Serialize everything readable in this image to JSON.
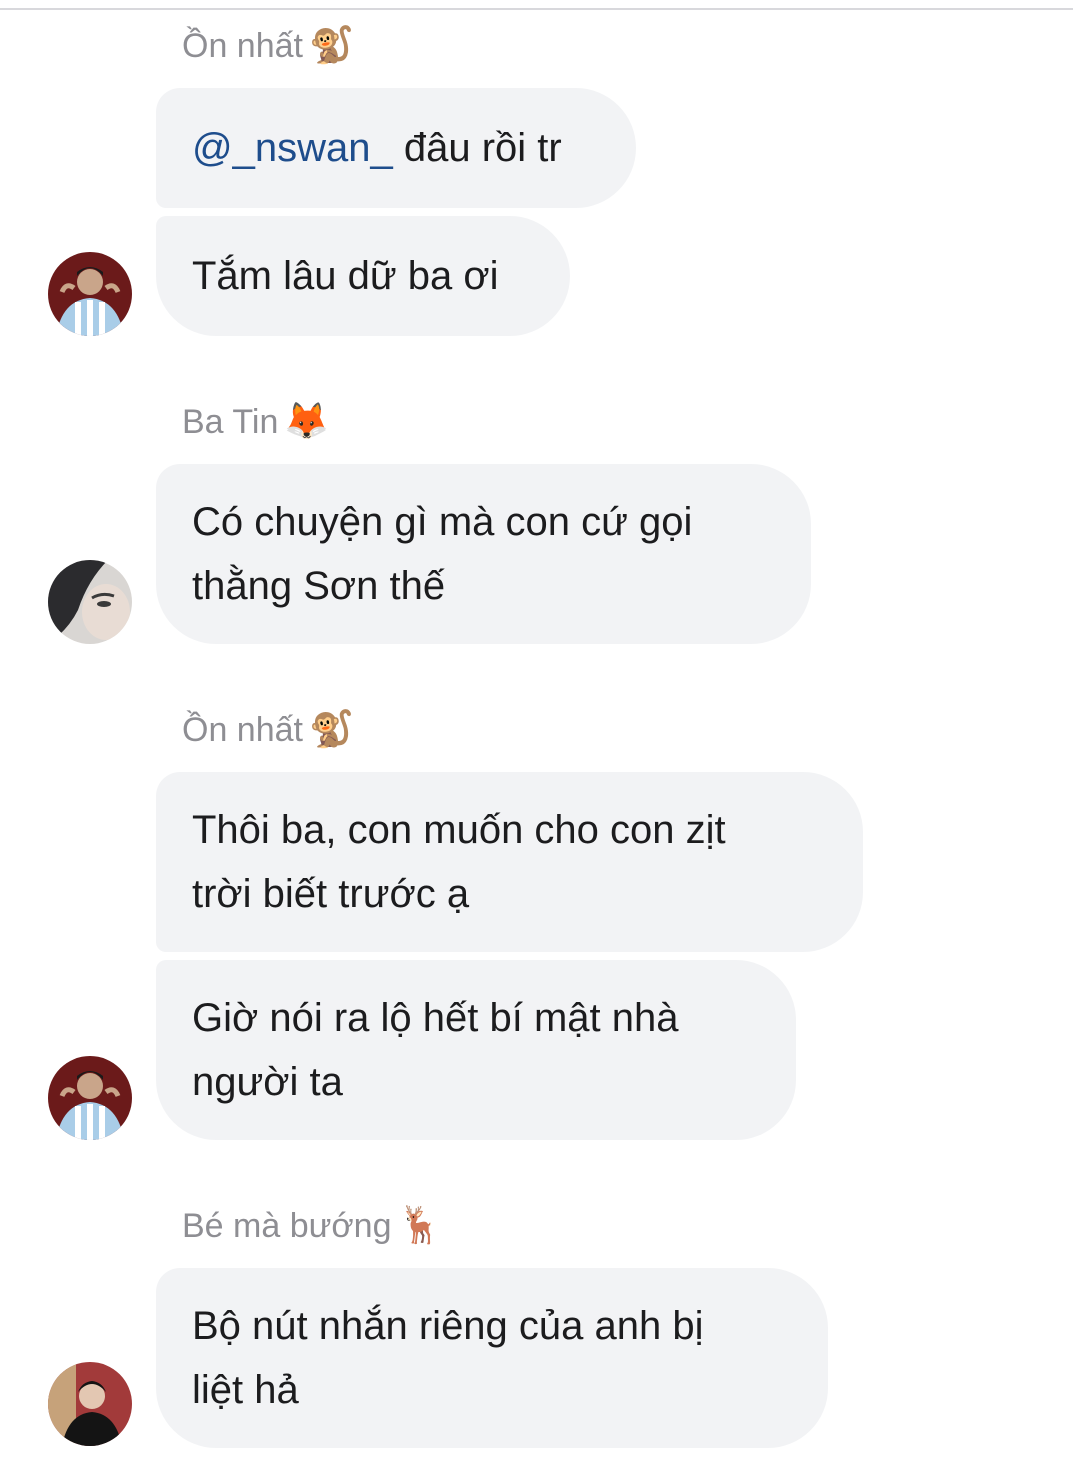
{
  "messages": [
    {
      "sender": "Ồn nhất",
      "sender_emoji": "🐒",
      "emoji_name": "monkey-emoji",
      "bubbles": [
        {
          "mention": "@_nswan_",
          "text": " đâu rồi tr"
        },
        {
          "text": "Tắm lâu dữ ba ơi"
        }
      ]
    },
    {
      "sender": "Ba Tin",
      "sender_emoji": "🦊",
      "emoji_name": "fox-emoji",
      "bubbles": [
        {
          "line1": "Có chuyện gì mà con cứ gọi",
          "line2": "thằng Sơn thế"
        }
      ]
    },
    {
      "sender": "Ồn nhất",
      "sender_emoji": "🐒",
      "emoji_name": "monkey-emoji",
      "bubbles": [
        {
          "line1": "Thôi ba, con muốn cho con zịt",
          "line2": "trời biết trước ạ"
        },
        {
          "line1": "Giờ nói ra lộ hết bí mật nhà",
          "line2": "người ta"
        }
      ]
    },
    {
      "sender": "Bé mà bướng",
      "sender_emoji": "🦌",
      "emoji_name": "deer-emoji",
      "bubbles": [
        {
          "line1": "Bộ nút nhắn riêng của anh bị",
          "line2": "liệt hả"
        }
      ]
    }
  ],
  "colors": {
    "bubble_bg": "#f2f3f5",
    "mention": "#1e4d8c",
    "sender_name": "#8e8e93",
    "text": "#1c1c1e"
  }
}
